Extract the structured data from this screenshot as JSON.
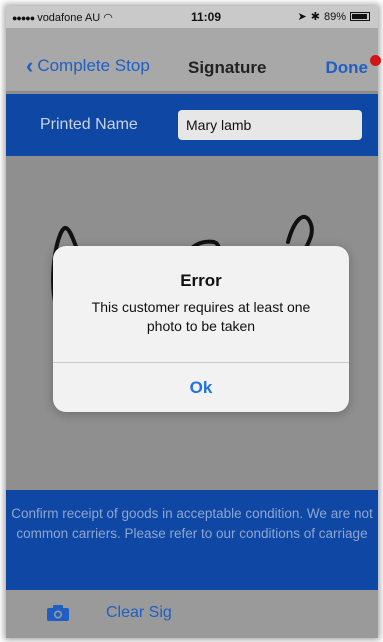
{
  "status_bar": {
    "carrier": "vodafone AU",
    "time": "11:09",
    "battery": "89%"
  },
  "nav": {
    "back_label": "Complete Stop",
    "title": "Signature",
    "done_label": "Done"
  },
  "form": {
    "printed_name_label": "Printed Name",
    "printed_name_value": "Mary lamb"
  },
  "terms_text": "Confirm receipt of goods in acceptable condition. We are not common carriers. Please refer to our conditions of carriage",
  "toolbar": {
    "camera_icon": "camera-icon",
    "clear_sig_label": "Clear Sig"
  },
  "alert": {
    "title": "Error",
    "message": "This customer requires at least one photo to be taken",
    "ok_label": "Ok"
  },
  "colors": {
    "accent_blue": "#1f5fc4",
    "banner_blue": "#0f47a4",
    "marker_red": "#d21414"
  }
}
